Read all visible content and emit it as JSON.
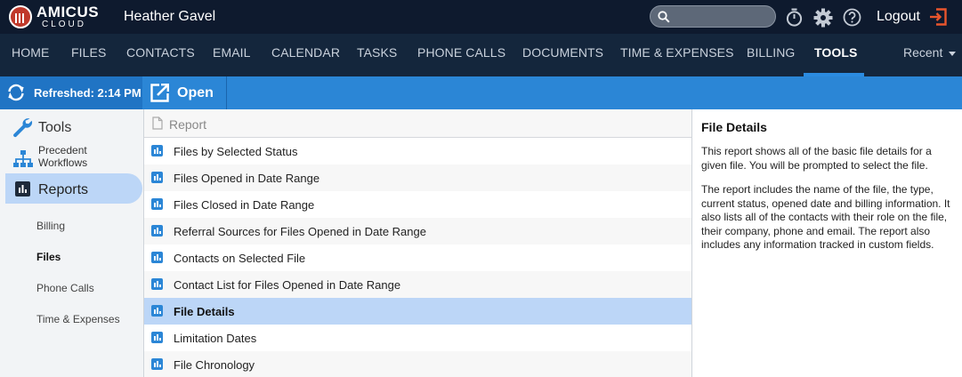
{
  "brand": {
    "name": "AMICUS",
    "sub": "CLOUD"
  },
  "topbar": {
    "user_name": "Heather Gavel",
    "search_placeholder": "",
    "logout_label": "Logout"
  },
  "nav": {
    "items": [
      {
        "label": "HOME"
      },
      {
        "label": "FILES"
      },
      {
        "label": "CONTACTS"
      },
      {
        "label": "EMAIL"
      },
      {
        "label": "CALENDAR"
      },
      {
        "label": "TASKS"
      },
      {
        "label": "PHONE CALLS"
      },
      {
        "label": "DOCUMENTS"
      },
      {
        "label": "TIME & EXPENSES"
      },
      {
        "label": "BILLING"
      },
      {
        "label": "TOOLS"
      }
    ],
    "active": "TOOLS",
    "recent_label": "Recent"
  },
  "actionbar": {
    "refreshed_label": "Refreshed: 2:14 PM",
    "open_label": "Open"
  },
  "sidebar": {
    "tools_label": "Tools",
    "precedent_label_1": "Precedent",
    "precedent_label_2": "Workflows",
    "reports_label": "Reports",
    "sub_items": [
      {
        "label": "Billing"
      },
      {
        "label": "Files"
      },
      {
        "label": "Phone Calls"
      },
      {
        "label": "Time & Expenses"
      }
    ],
    "active_sub": "Files"
  },
  "report_list": {
    "header": "Report",
    "rows": [
      {
        "label": "Files by Selected Status"
      },
      {
        "label": "Files Opened in Date Range"
      },
      {
        "label": "Files Closed in Date Range"
      },
      {
        "label": "Referral Sources for Files Opened in Date Range"
      },
      {
        "label": "Contacts on Selected File"
      },
      {
        "label": "Contact List for Files Opened in Date Range"
      },
      {
        "label": "File Details"
      },
      {
        "label": "Limitation Dates"
      },
      {
        "label": "File Chronology"
      }
    ],
    "selected": "File Details"
  },
  "details": {
    "title": "File Details",
    "para1": "This report shows all of the basic file details for a given file. You will be prompted to select the file.",
    "para2": "The report includes the name of the file, the type, current status, opened date and billing information. It also lists all of the contacts with their role on the file, their company, phone and email. The report also includes any information tracked in custom fields."
  },
  "colors": {
    "topbar_bg": "#0e1a2e",
    "nav_bg": "#14263c",
    "accent": "#2b86d6",
    "selection": "#bcd6f7",
    "logout_icon": "#e8552d"
  },
  "icons": {
    "search": "search-icon",
    "timer": "stopwatch-icon",
    "settings": "gear-icon",
    "help": "help-icon",
    "logout": "logout-icon",
    "refresh": "refresh-icon",
    "open": "open-external-icon",
    "tools": "wrench-icon",
    "precedent": "workflow-icon",
    "reports": "bar-chart-icon",
    "report_row": "report-chart-icon",
    "header_doc": "document-icon"
  }
}
